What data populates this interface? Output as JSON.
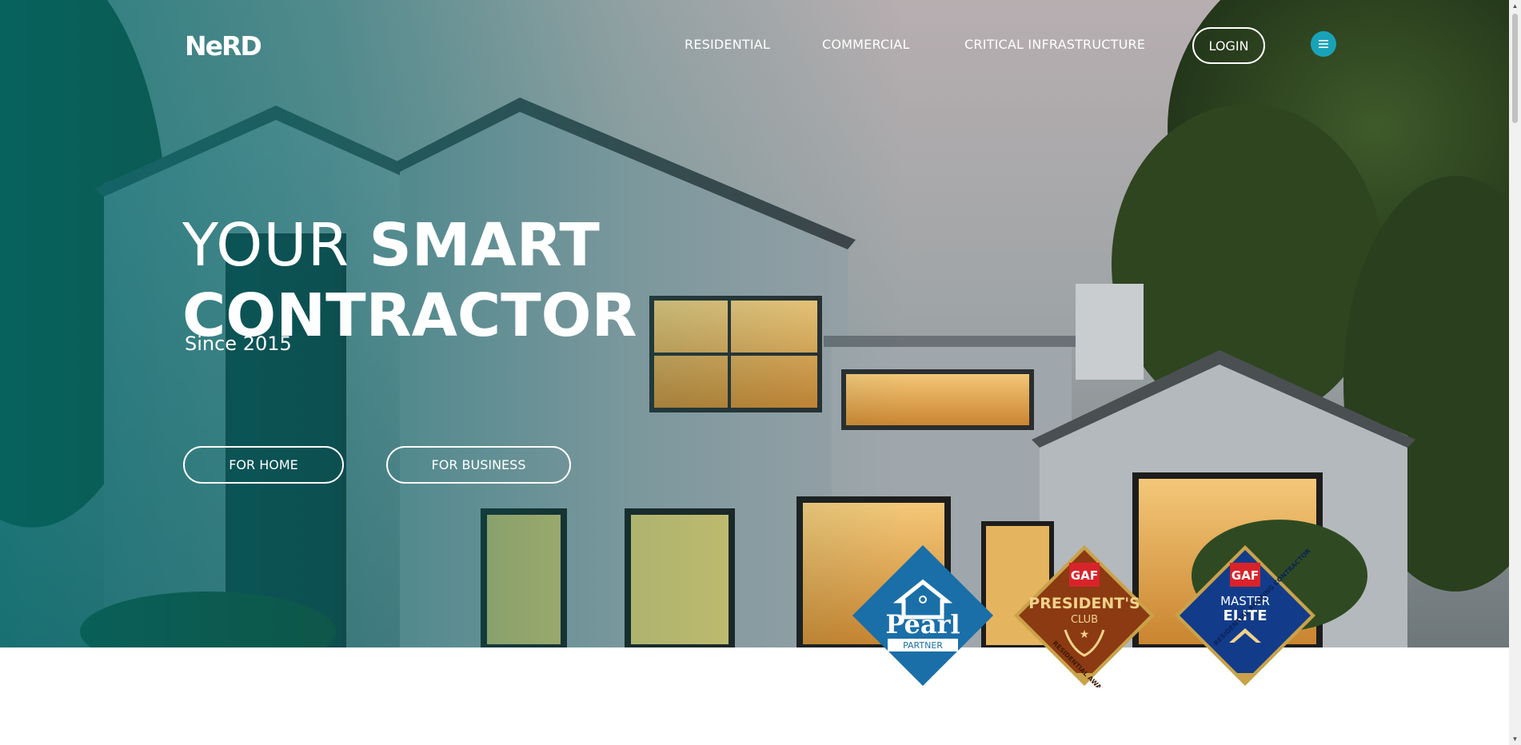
{
  "brand": {
    "logo_text": "NeRD"
  },
  "nav": {
    "residential": "RESIDENTIAL",
    "commercial": "COMMERCIAL",
    "critical_infrastructure": "CRITICAL INFRASTRUCTURE",
    "login": "LOGIN",
    "menu_icon": "hamburger-icon"
  },
  "hero": {
    "headline_thin": "YOUR ",
    "headline_bold_1": "SMART",
    "headline_bold_2": "CONTRACTOR",
    "since": "Since 2015",
    "cta_home": "FOR HOME",
    "cta_business": "FOR BUSINESS"
  },
  "badges": {
    "pearl": {
      "name": "Pearl",
      "sub": "PARTNER"
    },
    "presidents": {
      "brand": "GAF",
      "name": "PRESIDENT'S",
      "sub": "CLUB",
      "ribbon": "RESIDENTIAL AWARD WINNER"
    },
    "master": {
      "brand": "GAF",
      "name_1": "MASTER",
      "name_2": "ELITE",
      "ribbon": "RESIDENTIAL ROOFING CONTRACTOR"
    }
  },
  "colors": {
    "accent": "#1aa3b8",
    "pearl_blue": "#1a6fa8",
    "presidents_brown": "#8b3a12",
    "master_navy": "#123c8a",
    "gold": "#c9a24a",
    "gaf_red": "#d8232a"
  }
}
